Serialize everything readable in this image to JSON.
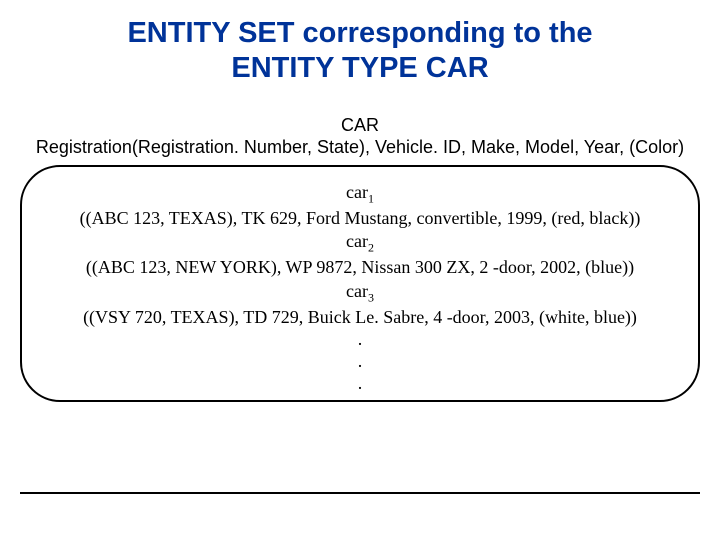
{
  "title_line1": "ENTITY SET corresponding to the",
  "title_line2": "ENTITY TYPE CAR",
  "schema": {
    "entity_name": "CAR",
    "attributes": "Registration(Registration. Number, State), Vehicle. ID, Make, Model, Year, (Color)"
  },
  "entries": [
    {
      "label_prefix": "car",
      "label_sub": "1",
      "tuple": "((ABC 123, TEXAS), TK 629, Ford Mustang, convertible, 1999, (red, black))"
    },
    {
      "label_prefix": "car",
      "label_sub": "2",
      "tuple": "((ABC 123, NEW YORK), WP 9872, Nissan 300 ZX, 2 -door, 2002, (blue))"
    },
    {
      "label_prefix": "car",
      "label_sub": "3",
      "tuple": "((VSY 720, TEXAS), TD 729, Buick Le. Sabre, 4 -door, 2003, (white, blue))"
    }
  ],
  "dots": [
    ".",
    ".",
    "."
  ]
}
